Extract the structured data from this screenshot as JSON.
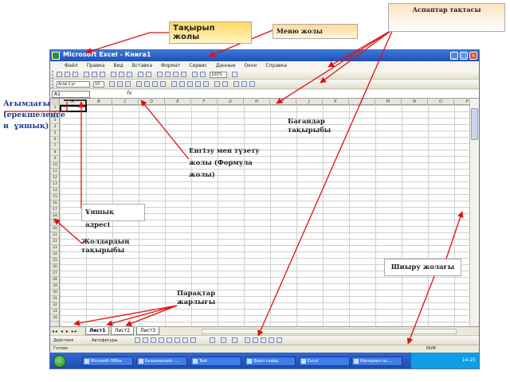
{
  "window": {
    "title": "Microsoft Excel - Книга1",
    "menu": [
      "Файл",
      "Правка",
      "Вид",
      "Вставка",
      "Формат",
      "Сервис",
      "Данные",
      "Окно",
      "Справка"
    ],
    "font_name": "Arial Cyr",
    "font_size": "10",
    "zoom": "100%",
    "name_box": "A1",
    "fx_label": "fx",
    "columns": [
      "A",
      "B",
      "C",
      "D",
      "E",
      "F",
      "G",
      "H",
      "I",
      "J",
      "K",
      "L",
      "M",
      "N",
      "O",
      "P"
    ],
    "rows": [
      "1",
      "2",
      "3",
      "4",
      "5",
      "6",
      "7",
      "8",
      "9",
      "10",
      "11",
      "12",
      "13",
      "14",
      "15",
      "16",
      "17",
      "18",
      "19",
      "20",
      "21",
      "22",
      "23",
      "24",
      "25",
      "26",
      "27",
      "28",
      "29",
      "30",
      "31",
      "32",
      "33",
      "34"
    ],
    "sheet_nav": "◂◂ ◂ ▸ ▸▸",
    "sheets": [
      "Лист1",
      "Лист2",
      "Лист3"
    ],
    "draw_labels": [
      "Действия",
      "Автофигуры"
    ],
    "status_left": "Готово",
    "status_right": "NUM"
  },
  "taskbar": {
    "items": [
      "Microsoft Office",
      "Безымянный - ...",
      "Text",
      "Файл слайд",
      "Excel",
      "Материал по ..."
    ],
    "clock": "14:25"
  },
  "annotations": {
    "toolbars": "Аспаптар тақтасы",
    "title_bar_line1": "Тақырып",
    "title_bar_line2": "жолы",
    "menu_bar": "Меню жолы",
    "active_cell_line1": "Ағымдағы",
    "active_cell_line2": "(ерекшеленге",
    "active_cell_line3": "н  ұяшық)",
    "column_headers_line1": "Бағандар",
    "column_headers_line2": "тақырыбы",
    "formula_line1": "Енгізу мен түзету",
    "formula_line2": "жолы (Формула",
    "formula_line3": "жолы)",
    "cell_address": "Ұяшық адресі",
    "row_headers_line1": "Жолдардың",
    "row_headers_line2": "тақырыбы",
    "scrollbar": "Шиыру жолағы",
    "sheets_line1": "Парақтар",
    "sheets_line2": "жарлығы"
  },
  "colors": {
    "arrow": "#e01010",
    "title_bar": "#1f4fb8",
    "active_text": "#1c3c91"
  }
}
